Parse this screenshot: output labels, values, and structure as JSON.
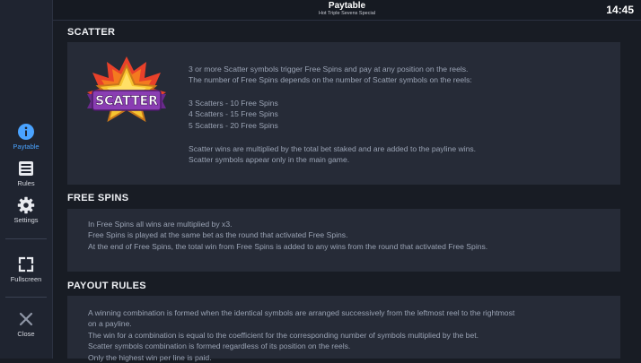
{
  "header": {
    "title": "Paytable",
    "subtitle": "Hot Triple Sevens Special",
    "clock": "14:45"
  },
  "sidebar": {
    "items": [
      {
        "label": "Paytable",
        "icon": "info-icon",
        "active": true
      },
      {
        "label": "Rules",
        "icon": "list-icon",
        "active": false
      },
      {
        "label": "Settings",
        "icon": "gear-icon",
        "active": false
      },
      {
        "label": "Fullscreen",
        "icon": "fullscreen-icon",
        "active": false
      },
      {
        "label": "Close",
        "icon": "close-icon",
        "active": false
      }
    ]
  },
  "scatter": {
    "title": "SCATTER",
    "badge_text": "SCATTER",
    "lines": [
      "3 or more Scatter symbols trigger Free Spins and pay at any position on the reels.",
      "The number of Free Spins depends on the number of Scatter symbols on the reels:",
      "3 Scatters - 10 Free Spins",
      "4 Scatters - 15 Free Spins",
      "5 Scatters - 20 Free Spins",
      "Scatter wins are multiplied by the total bet staked and are added to the payline wins.",
      "Scatter symbols appear only in the main game."
    ]
  },
  "free_spins": {
    "title": "FREE SPINS",
    "lines": [
      "In Free Spins all wins are multiplied by x3.",
      "Free Spins is played at the same bet as the round that activated Free Spins.",
      "At the end of Free Spins, the total win from Free Spins is added to any wins from the round that activated Free Spins."
    ]
  },
  "payout_rules": {
    "title": "PAYOUT RULES",
    "lines": [
      "A winning combination is formed when the identical symbols are arranged successively from the leftmost reel to the rightmost",
      "on a payline.",
      "The win for a combination is equal to the coefficient for the corresponding number of symbols multiplied by the bet.",
      "Scatter symbols combination is formed regardless of its position on the reels.",
      "Only the highest win per line is paid."
    ]
  },
  "colors": {
    "accent": "#4aa3ff",
    "background": "#181c24",
    "panel": "#262b37",
    "text_muted": "#9aa3b4"
  }
}
